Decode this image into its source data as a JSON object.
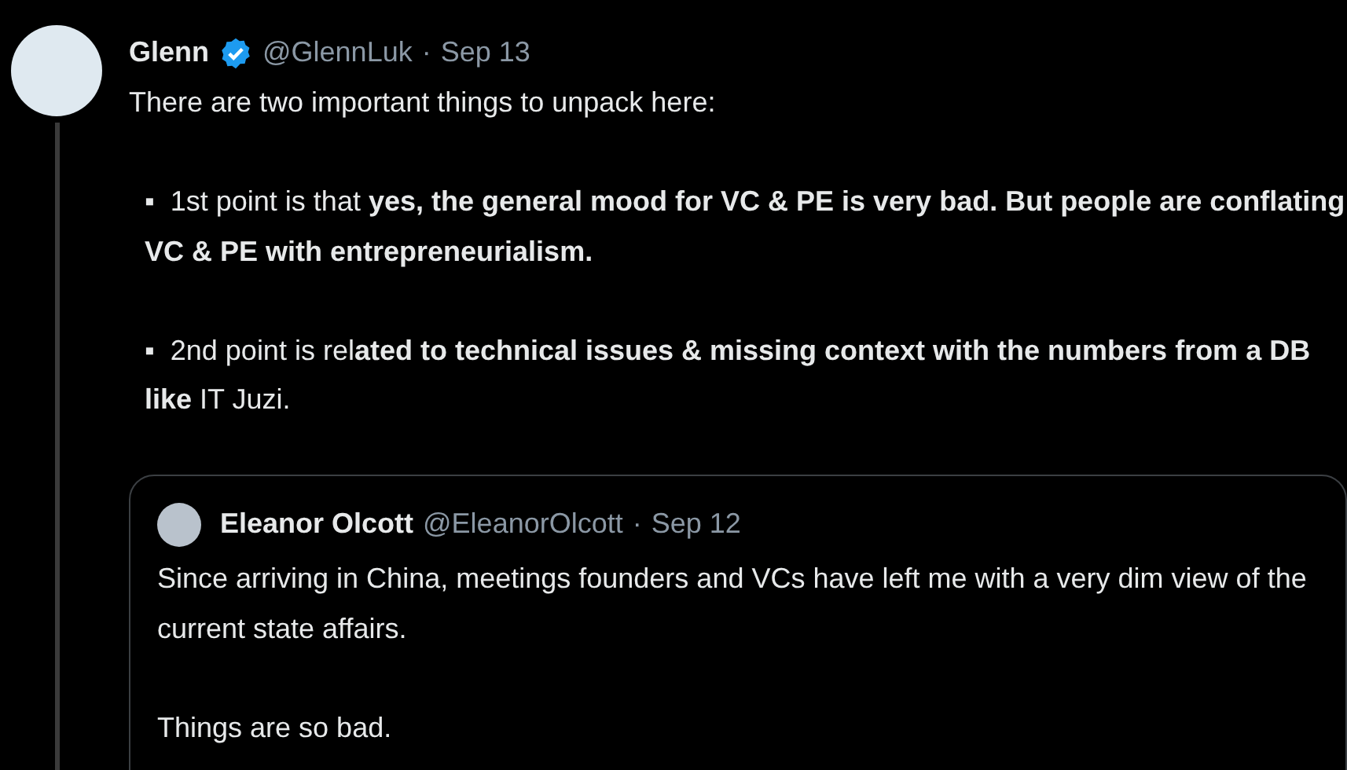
{
  "tweet": {
    "author": {
      "name": "Glenn",
      "verified": true,
      "handle": "@GlennLuk",
      "separator": "·",
      "date": "Sep 13"
    },
    "paragraphs": [
      {
        "kind": "plain",
        "text": "There are two important things to unpack here:"
      },
      {
        "kind": "bullet",
        "text": "▪  1st point is that **yes, the general mood for VC & PE is very bad. But people are conflating VC & PE with entrepreneurialism.**"
      },
      {
        "kind": "bullet",
        "text": "▪  2nd point is rel**ated to technical issues & missing context with the numbers from a DB like** IT Juzi."
      }
    ],
    "quoted_tweet": {
      "author": {
        "name": "Eleanor Olcott",
        "handle": "@EleanorOlcott",
        "separator": "·",
        "date": "Sep 12"
      },
      "paragraphs": [
        "Since arriving in China, meetings founders and VCs have left me with a very dim view of the current state affairs.",
        "Things are so bad."
      ]
    }
  }
}
